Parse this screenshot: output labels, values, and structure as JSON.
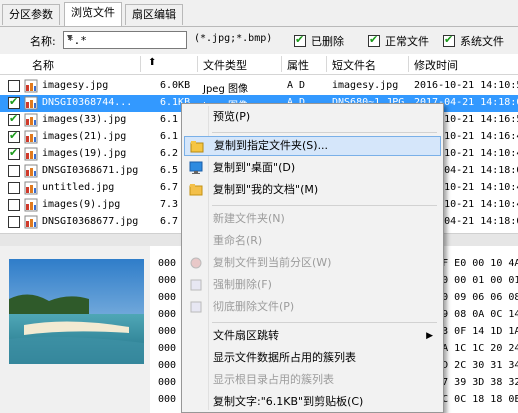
{
  "tabs": [
    "分区参数",
    "浏览文件",
    "扇区编辑"
  ],
  "filter": {
    "name_label": "名称:",
    "name_value": "*.*",
    "hint": "(*.jpg;*.bmp)",
    "checkboxes": [
      {
        "label": "已删除",
        "checked": true
      },
      {
        "label": "正常文件",
        "checked": true
      },
      {
        "label": "系统文件",
        "checked": true
      }
    ]
  },
  "columns": {
    "name": "名称",
    "type": "文件类型",
    "attr": "属性",
    "short": "短文件名",
    "mtime": "修改时间"
  },
  "files": [
    {
      "name": "imagesy.jpg",
      "size": "6.0KB",
      "type": "Jpeg 图像",
      "attr": "A D",
      "short": "imagesy.jpg",
      "mtime": "2016-10-21  14:10:5",
      "checked": false,
      "selected": false
    },
    {
      "name": "DNSGI0368744...",
      "size": "6.1KB",
      "type": "Jpeg 图像",
      "attr": "A D",
      "short": "DNS680~1.JPG",
      "mtime": "2017-04-21  14:18:0",
      "checked": true,
      "selected": true
    },
    {
      "name": "images(33).jpg",
      "size": "6.1",
      "type": "",
      "attr": "",
      "short": "",
      "mtime": "2016-10-21  14:16:5",
      "checked": true,
      "selected": false
    },
    {
      "name": "images(21).jpg",
      "size": "6.1",
      "type": "",
      "attr": "",
      "short": "",
      "mtime": "2016-10-21  14:16:4",
      "checked": true,
      "selected": false
    },
    {
      "name": "images(19).jpg",
      "size": "6.2",
      "type": "",
      "attr": "",
      "short": "",
      "mtime": "2016-10-21  14:10:4",
      "checked": true,
      "selected": false
    },
    {
      "name": "DNSGI0368671.jpg",
      "size": "6.5",
      "type": "",
      "attr": "",
      "short": "",
      "mtime": "2017-04-21  14:18:0",
      "checked": false,
      "selected": false
    },
    {
      "name": "untitled.jpg",
      "size": "6.7",
      "type": "",
      "attr": "",
      "short": "",
      "mtime": "2016-10-21  14:10:4",
      "checked": false,
      "selected": false
    },
    {
      "name": "images(9).jpg",
      "size": "7.3",
      "type": "",
      "attr": "",
      "short": "",
      "mtime": "2016-10-21  14:10:4",
      "checked": false,
      "selected": false
    },
    {
      "name": "DNSGI0368677.jpg",
      "size": "6.7",
      "type": "",
      "attr": "",
      "short": "",
      "mtime": "2017-04-21  14:18:0",
      "checked": false,
      "selected": false
    }
  ],
  "hex": {
    "offsets": [
      "000",
      "000",
      "000",
      "000",
      "000",
      "000",
      "000",
      "000",
      "000"
    ],
    "right": [
      "FF D8 FF E0 00 10 4A",
      "01 01 00 00 01 00 01",
      "00 43 00 09 06 06 08",
      "08 0A 09 08 0A 0C 14",
      "19 12 13 0F 14 1D 1A",
      "1E 1D 1A 1C 1C 20 24",
      "2D 2D 2D 2C 30 31 34",
      "34 1F 27 39 3D 38 32",
      "03 02 0C 0C 18 18 0E"
    ]
  },
  "menu": {
    "items": [
      {
        "label": "预览(P)",
        "disabled": false,
        "icon": "",
        "highlight": false
      },
      {
        "sep": true
      },
      {
        "label": "复制到指定文件夹(S)...",
        "disabled": false,
        "icon": "copy-icon",
        "highlight": true
      },
      {
        "label": "复制到\"桌面\"(D)",
        "disabled": false,
        "icon": "desktop-icon",
        "highlight": false
      },
      {
        "label": "复制到\"我的文档\"(M)",
        "disabled": false,
        "icon": "folder-icon",
        "highlight": false
      },
      {
        "sep": true
      },
      {
        "label": "新建文件夹(N)",
        "disabled": true,
        "icon": "",
        "highlight": false
      },
      {
        "label": "重命名(R)",
        "disabled": true,
        "icon": "",
        "highlight": false
      },
      {
        "label": "复制文件到当前分区(W)",
        "disabled": true,
        "icon": "copy-partition-icon",
        "highlight": false
      },
      {
        "label": "强制删除(F)",
        "disabled": true,
        "icon": "force-delete-icon",
        "highlight": false
      },
      {
        "label": "彻底删除文件(P)",
        "disabled": true,
        "icon": "wipe-icon",
        "highlight": false
      },
      {
        "sep": true
      },
      {
        "label": "文件扇区跳转",
        "disabled": false,
        "icon": "",
        "highlight": false,
        "submenu": true
      },
      {
        "label": "显示文件数据所占用的簇列表",
        "disabled": false,
        "icon": "",
        "highlight": false
      },
      {
        "label": "显示根目录占用的簇列表",
        "disabled": true,
        "icon": "",
        "highlight": false
      },
      {
        "label": "复制文字:\"6.1KB\"到剪贴板(C)",
        "disabled": false,
        "icon": "",
        "highlight": false
      }
    ]
  },
  "colors": {
    "selection": "#3399ff",
    "menu_highlight": "#d5e6fa",
    "check": "#1a9a1a"
  }
}
